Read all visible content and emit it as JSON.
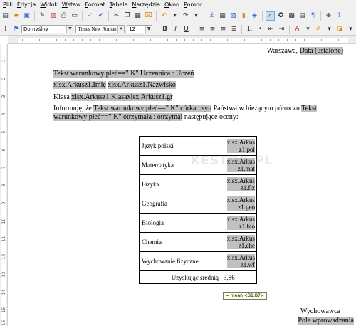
{
  "menu": [
    "Plik",
    "Edycja",
    "Widok",
    "Wstaw",
    "Format",
    "Tabela",
    "Narzędzia",
    "Okno",
    "Pomoc"
  ],
  "toolbar": {
    "paragraph_style": "Domyślny",
    "font_name": "Times New Roman",
    "font_size": "12",
    "icons_row1": [
      "new-document-icon",
      "open-icon",
      "save-icon",
      "edit-document-icon",
      "pdf-export-icon",
      "print-icon",
      "spellcheck-icon",
      "autocheck-icon",
      "cut-icon",
      "copy-icon",
      "paste-icon",
      "format-paintbrush-icon",
      "undo-icon",
      "redo-icon",
      "hyperlink-icon",
      "table-icon",
      "image-icon",
      "chart-icon",
      "show-draw-functions-icon",
      "find-replace-icon",
      "navigator-icon",
      "gallery-icon",
      "data-sources-icon",
      "formatting-marks-icon",
      "zoom-icon",
      "help-icon"
    ],
    "icons_row2": [
      "styles-icon",
      "bold-icon",
      "italic-icon",
      "underline-icon",
      "align-left-icon",
      "center-icon",
      "align-right-icon",
      "justify-icon",
      "numbering-icon",
      "bullets-icon",
      "decrease-indent-icon",
      "increase-indent-icon",
      "font-color-icon",
      "highlight-icon",
      "background-color-icon"
    ]
  },
  "document": {
    "place": "Warszawa, ",
    "date_field": "Data (ustalone)",
    "cond_field_1": "Tekst warunkowy płeć==\" K\" Uczennica : Uczeń",
    "first_name_field": "xlsx.Arkusz1.Imię",
    "last_name_field": "xlsx.Arkusz1.Nazwisko",
    "class_label": "Klasa ",
    "class_field": "xlsx.Arkusz1.Klasaxlsx.Arkusz1.gr",
    "inform_prefix": "Informuję, że ",
    "cond_field_2": "Tekst warunkowy płeć==\" K\" córka : syn",
    "inform_mid": " Państwa  w bieżącym półroczu ",
    "cond_field_3a": "Tekst",
    "cond_field_3b": "warunkowy płeć==\" K\" otrzymała : otrzymał",
    "inform_suffix": " następujące oceny:",
    "signature_label": "Wychowawca",
    "input_field": "Pole wprowadzania"
  },
  "grades_table": {
    "rows": [
      {
        "subject": "Język polski",
        "g1": "xlsx.Arkus",
        "g2": "z1.pol"
      },
      {
        "subject": "Matematyka",
        "g1": "xlsx.Arkus",
        "g2": "z1.mat"
      },
      {
        "subject": "Fizyka",
        "g1": "xlsx.Arkus",
        "g2": "z1.fiz"
      },
      {
        "subject": "Geografia",
        "g1": "xlsx.Arkus",
        "g2": "z1.geo"
      },
      {
        "subject": "Biologia",
        "g1": "xlsx.Arkus",
        "g2": "z1.bio"
      },
      {
        "subject": "Chemia",
        "g1": "xlsx.Arkus",
        "g2": "z1.che"
      },
      {
        "subject": "Wychowanie fizyczne",
        "g1": "xlsx.Arkus",
        "g2": "z1.wf"
      }
    ],
    "average_label": "Uzyskując średnią",
    "average_value": "3,86"
  },
  "tooltip": "= mean <B1:B7>",
  "watermark": "KESTOK.PL",
  "ruler_numbers": [
    "1",
    "2",
    "3",
    "4",
    "5",
    "6",
    "7",
    "8",
    "9",
    "10",
    "11",
    "12",
    "13",
    "14",
    "15",
    "16"
  ]
}
